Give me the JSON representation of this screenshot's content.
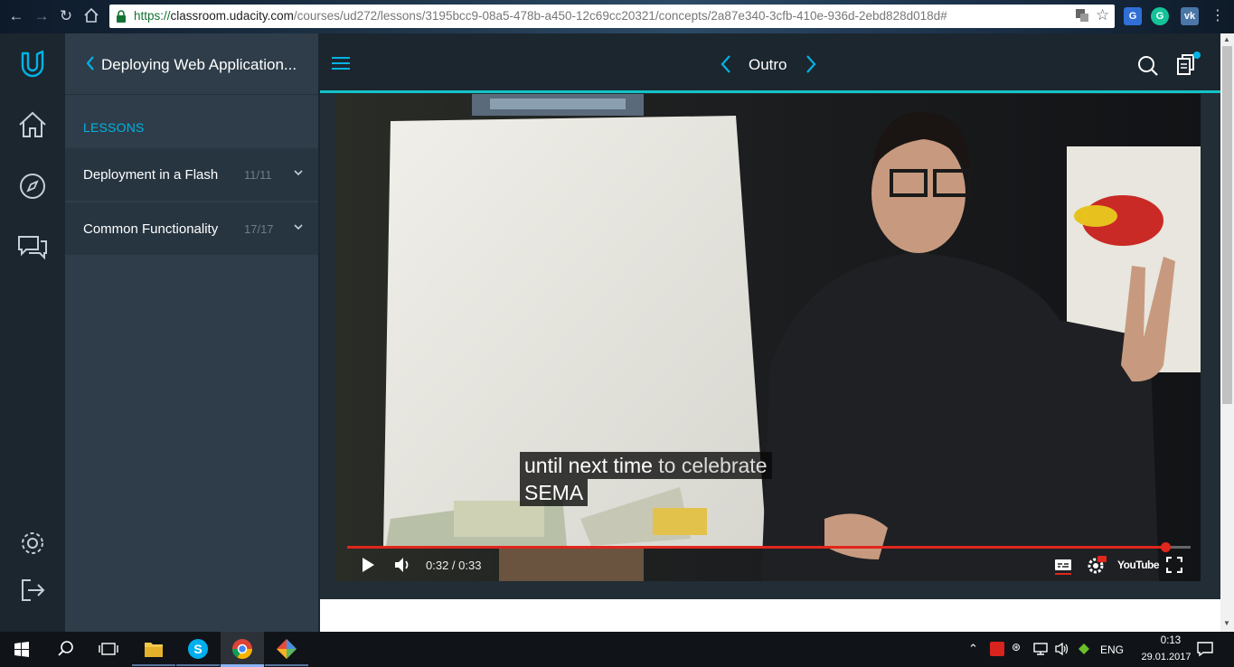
{
  "browser": {
    "url_scheme": "https://",
    "url_host": "classroom.udacity.com",
    "url_path": "/courses/ud272/lessons/3195bcc9-08a5-478b-a450-12c69cc20321/concepts/2a87e340-3cfb-410e-936d-2ebd828d018d#"
  },
  "sidebar": {
    "course_title": "Deploying Web Application...",
    "lessons_label": "LESSONS",
    "lessons": [
      {
        "title": "Deployment in a Flash",
        "count": "11/11"
      },
      {
        "title": "Common Functionality",
        "count": "17/17"
      }
    ]
  },
  "header": {
    "concept_title": "Outro"
  },
  "video": {
    "subtitle_line1_a": "until next time",
    "subtitle_line1_b": "to celebrate",
    "subtitle_line2": "SEMA",
    "time": "0:32 / 0:33",
    "progress": 0.97,
    "youtube_label": "YouTube"
  },
  "taskbar": {
    "language": "ENG",
    "time": "0:13",
    "date": "29.01.2017"
  },
  "colors": {
    "accent": "#02b3e4",
    "header_underline": "#15c3c7",
    "progress": "#e1261c"
  }
}
